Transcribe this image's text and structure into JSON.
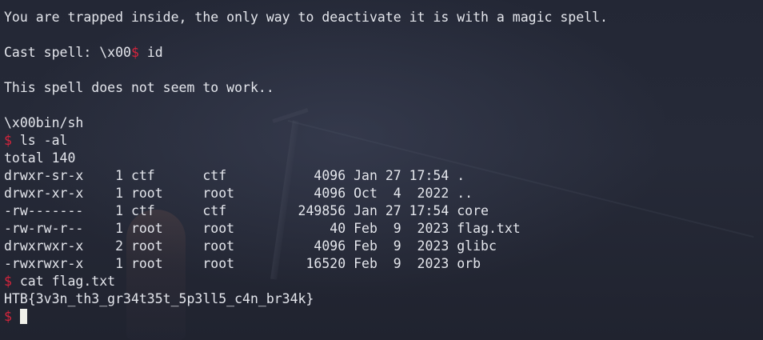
{
  "terminal": {
    "intro": "You are trapped inside, the only way to deactivate it is with a magic spell.",
    "spell_label": "Cast spell: \\x00",
    "prompt_symbol": "$",
    "spell_command": " id",
    "spell_result": "This spell does not seem to work..",
    "shell_line": "\\x00bin/sh",
    "ls_command": " ls -al",
    "ls_output": [
      "total 140",
      "drwxr-sr-x    1 ctf      ctf           4096 Jan 27 17:54 .",
      "drwxr-xr-x    1 root     root          4096 Oct  4  2022 ..",
      "-rw-------    1 ctf      ctf         249856 Jan 27 17:54 core",
      "-rw-rw-r--    1 root     root            40 Feb  9  2023 flag.txt",
      "drwxrwxr-x    2 root     root          4096 Feb  9  2023 glibc",
      "-rwxrwxr-x    1 root     root         16520 Feb  9  2023 orb"
    ],
    "cat_command": " cat flag.txt",
    "flag": "HTB{3v3n_th3_gr34t35t_5p3ll5_c4n_br34k}"
  },
  "colors": {
    "background": "#222633",
    "text": "#e4e6ec",
    "prompt": "#d8243c",
    "cursor": "#f1f1ea"
  }
}
